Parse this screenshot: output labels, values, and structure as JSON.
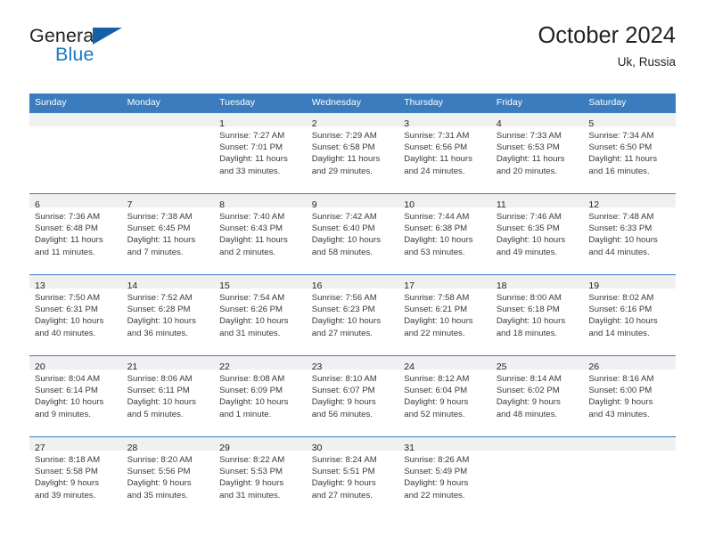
{
  "logo": {
    "word_primary": "General",
    "word_secondary": "Blue",
    "triangle_icon": "triangle-icon"
  },
  "header": {
    "title": "October 2024",
    "subtitle": "Uk, Russia"
  },
  "colors": {
    "header_blue": "#3a7cbe",
    "logo_blue": "#1a7bc4",
    "logo_triangle_blue": "#1560a8",
    "day_band_gray": "#f0f0f0",
    "text": "#231f20"
  },
  "weekday_headers": [
    "Sunday",
    "Monday",
    "Tuesday",
    "Wednesday",
    "Thursday",
    "Friday",
    "Saturday"
  ],
  "weeks": [
    [
      {
        "day": "",
        "lines": []
      },
      {
        "day": "",
        "lines": []
      },
      {
        "day": "1",
        "lines": [
          "Sunrise: 7:27 AM",
          "Sunset: 7:01 PM",
          "Daylight: 11 hours",
          "and 33 minutes."
        ]
      },
      {
        "day": "2",
        "lines": [
          "Sunrise: 7:29 AM",
          "Sunset: 6:58 PM",
          "Daylight: 11 hours",
          "and 29 minutes."
        ]
      },
      {
        "day": "3",
        "lines": [
          "Sunrise: 7:31 AM",
          "Sunset: 6:56 PM",
          "Daylight: 11 hours",
          "and 24 minutes."
        ]
      },
      {
        "day": "4",
        "lines": [
          "Sunrise: 7:33 AM",
          "Sunset: 6:53 PM",
          "Daylight: 11 hours",
          "and 20 minutes."
        ]
      },
      {
        "day": "5",
        "lines": [
          "Sunrise: 7:34 AM",
          "Sunset: 6:50 PM",
          "Daylight: 11 hours",
          "and 16 minutes."
        ]
      }
    ],
    [
      {
        "day": "6",
        "lines": [
          "Sunrise: 7:36 AM",
          "Sunset: 6:48 PM",
          "Daylight: 11 hours",
          "and 11 minutes."
        ]
      },
      {
        "day": "7",
        "lines": [
          "Sunrise: 7:38 AM",
          "Sunset: 6:45 PM",
          "Daylight: 11 hours",
          "and 7 minutes."
        ]
      },
      {
        "day": "8",
        "lines": [
          "Sunrise: 7:40 AM",
          "Sunset: 6:43 PM",
          "Daylight: 11 hours",
          "and 2 minutes."
        ]
      },
      {
        "day": "9",
        "lines": [
          "Sunrise: 7:42 AM",
          "Sunset: 6:40 PM",
          "Daylight: 10 hours",
          "and 58 minutes."
        ]
      },
      {
        "day": "10",
        "lines": [
          "Sunrise: 7:44 AM",
          "Sunset: 6:38 PM",
          "Daylight: 10 hours",
          "and 53 minutes."
        ]
      },
      {
        "day": "11",
        "lines": [
          "Sunrise: 7:46 AM",
          "Sunset: 6:35 PM",
          "Daylight: 10 hours",
          "and 49 minutes."
        ]
      },
      {
        "day": "12",
        "lines": [
          "Sunrise: 7:48 AM",
          "Sunset: 6:33 PM",
          "Daylight: 10 hours",
          "and 44 minutes."
        ]
      }
    ],
    [
      {
        "day": "13",
        "lines": [
          "Sunrise: 7:50 AM",
          "Sunset: 6:31 PM",
          "Daylight: 10 hours",
          "and 40 minutes."
        ]
      },
      {
        "day": "14",
        "lines": [
          "Sunrise: 7:52 AM",
          "Sunset: 6:28 PM",
          "Daylight: 10 hours",
          "and 36 minutes."
        ]
      },
      {
        "day": "15",
        "lines": [
          "Sunrise: 7:54 AM",
          "Sunset: 6:26 PM",
          "Daylight: 10 hours",
          "and 31 minutes."
        ]
      },
      {
        "day": "16",
        "lines": [
          "Sunrise: 7:56 AM",
          "Sunset: 6:23 PM",
          "Daylight: 10 hours",
          "and 27 minutes."
        ]
      },
      {
        "day": "17",
        "lines": [
          "Sunrise: 7:58 AM",
          "Sunset: 6:21 PM",
          "Daylight: 10 hours",
          "and 22 minutes."
        ]
      },
      {
        "day": "18",
        "lines": [
          "Sunrise: 8:00 AM",
          "Sunset: 6:18 PM",
          "Daylight: 10 hours",
          "and 18 minutes."
        ]
      },
      {
        "day": "19",
        "lines": [
          "Sunrise: 8:02 AM",
          "Sunset: 6:16 PM",
          "Daylight: 10 hours",
          "and 14 minutes."
        ]
      }
    ],
    [
      {
        "day": "20",
        "lines": [
          "Sunrise: 8:04 AM",
          "Sunset: 6:14 PM",
          "Daylight: 10 hours",
          "and 9 minutes."
        ]
      },
      {
        "day": "21",
        "lines": [
          "Sunrise: 8:06 AM",
          "Sunset: 6:11 PM",
          "Daylight: 10 hours",
          "and 5 minutes."
        ]
      },
      {
        "day": "22",
        "lines": [
          "Sunrise: 8:08 AM",
          "Sunset: 6:09 PM",
          "Daylight: 10 hours",
          "and 1 minute."
        ]
      },
      {
        "day": "23",
        "lines": [
          "Sunrise: 8:10 AM",
          "Sunset: 6:07 PM",
          "Daylight: 9 hours",
          "and 56 minutes."
        ]
      },
      {
        "day": "24",
        "lines": [
          "Sunrise: 8:12 AM",
          "Sunset: 6:04 PM",
          "Daylight: 9 hours",
          "and 52 minutes."
        ]
      },
      {
        "day": "25",
        "lines": [
          "Sunrise: 8:14 AM",
          "Sunset: 6:02 PM",
          "Daylight: 9 hours",
          "and 48 minutes."
        ]
      },
      {
        "day": "26",
        "lines": [
          "Sunrise: 8:16 AM",
          "Sunset: 6:00 PM",
          "Daylight: 9 hours",
          "and 43 minutes."
        ]
      }
    ],
    [
      {
        "day": "27",
        "lines": [
          "Sunrise: 8:18 AM",
          "Sunset: 5:58 PM",
          "Daylight: 9 hours",
          "and 39 minutes."
        ]
      },
      {
        "day": "28",
        "lines": [
          "Sunrise: 8:20 AM",
          "Sunset: 5:56 PM",
          "Daylight: 9 hours",
          "and 35 minutes."
        ]
      },
      {
        "day": "29",
        "lines": [
          "Sunrise: 8:22 AM",
          "Sunset: 5:53 PM",
          "Daylight: 9 hours",
          "and 31 minutes."
        ]
      },
      {
        "day": "30",
        "lines": [
          "Sunrise: 8:24 AM",
          "Sunset: 5:51 PM",
          "Daylight: 9 hours",
          "and 27 minutes."
        ]
      },
      {
        "day": "31",
        "lines": [
          "Sunrise: 8:26 AM",
          "Sunset: 5:49 PM",
          "Daylight: 9 hours",
          "and 22 minutes."
        ]
      },
      {
        "day": "",
        "lines": []
      },
      {
        "day": "",
        "lines": []
      }
    ]
  ]
}
